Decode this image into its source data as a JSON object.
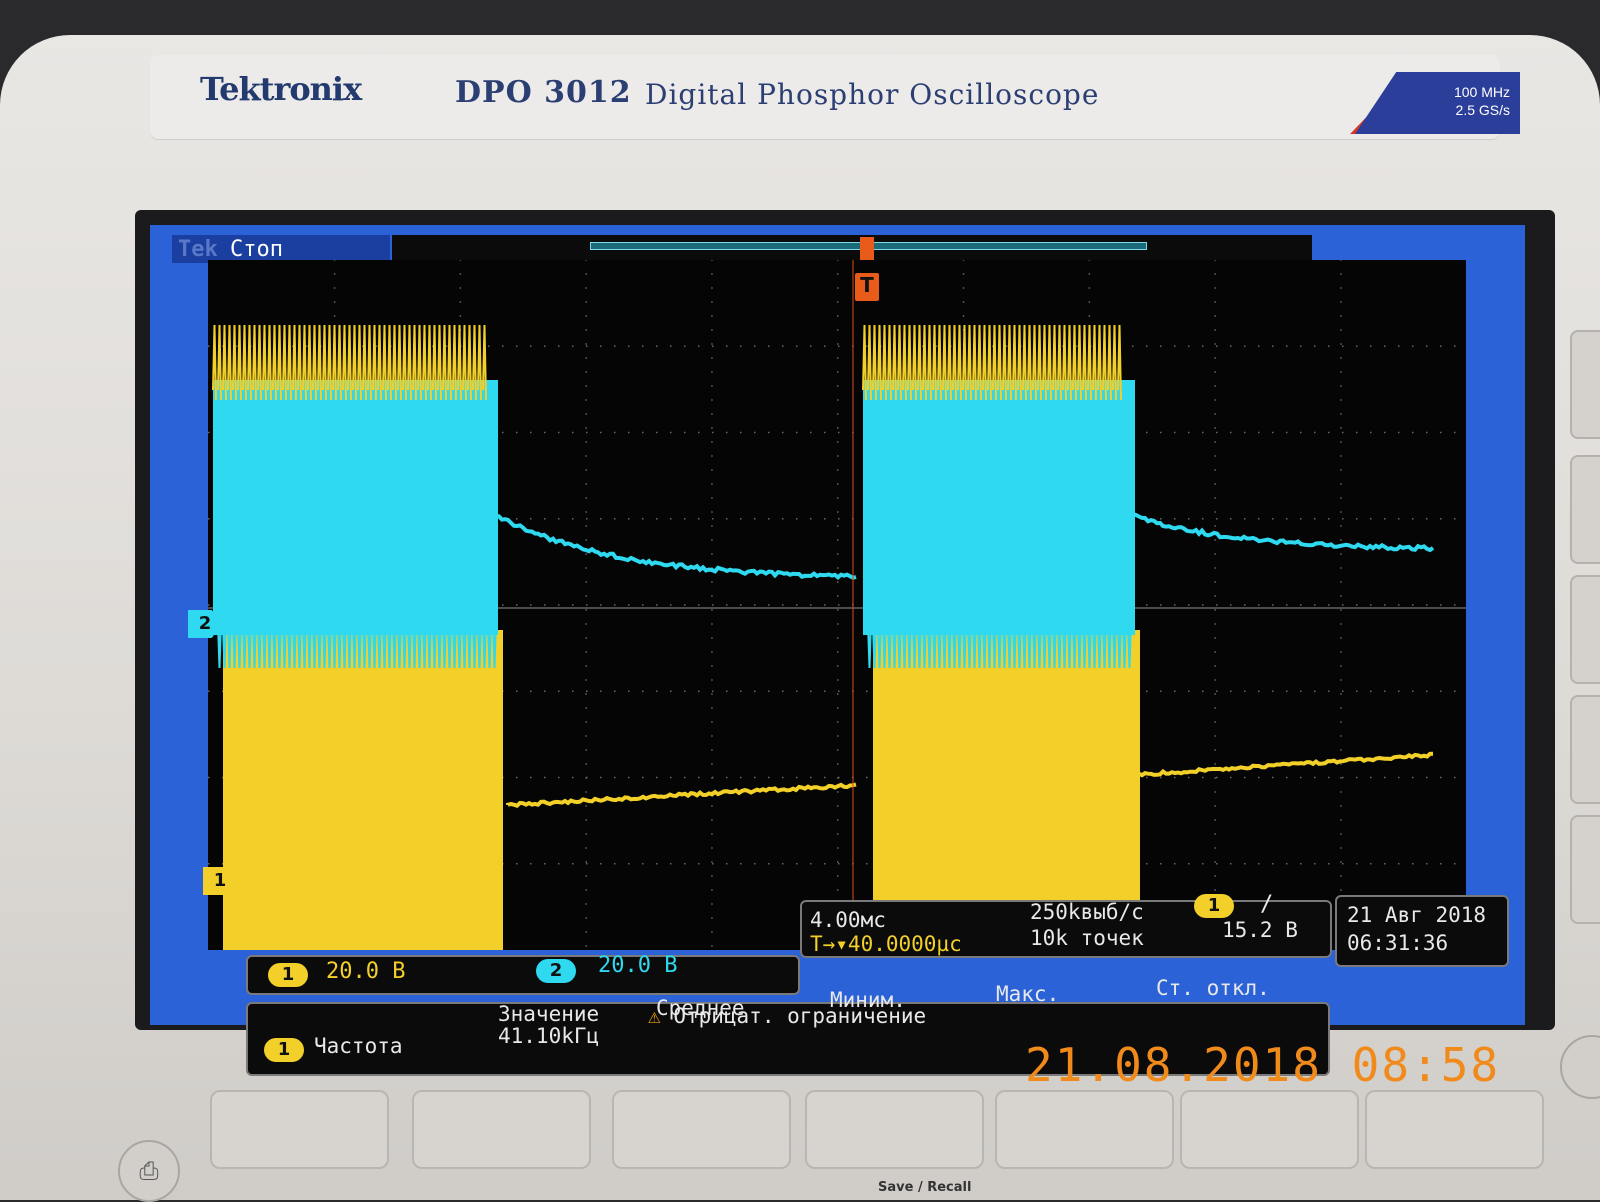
{
  "branding": {
    "brand": "Tektronix",
    "model": "DPO 3012",
    "model_desc": "Digital Phosphor Oscilloscope",
    "spec_bandwidth": "100 MHz",
    "spec_sample": "2.5 GS/s"
  },
  "screen": {
    "status": "Стоп",
    "logo": "Tek"
  },
  "channels": {
    "ch1": {
      "label": "1",
      "scale": "20.0 В",
      "color": "#f2d029"
    },
    "ch2": {
      "label": "2",
      "scale": "20.0 В",
      "color": "#2fd9ef"
    }
  },
  "timebase": {
    "time_div": "4.00мс",
    "trigger_position": "T→▾40.0000µс",
    "sample_rate": "250kвыб/с",
    "record_length": "10k точек"
  },
  "trigger": {
    "source": "1",
    "slope": "/",
    "level": "15.2 В"
  },
  "datetime": {
    "date": "21 Авг   2018",
    "time": "06:31:36"
  },
  "measurement": {
    "headers": {
      "value": "Значение",
      "mean": "Среднее",
      "min": "Миним.",
      "max": "Макс.",
      "std": "Ст. откл."
    },
    "source": "1",
    "name": "Частота",
    "value": "41.10kГц",
    "warning_icon": "warning-triangle-icon",
    "warning": "Отрицат. ограничение"
  },
  "photo_stamp": "21.08.2018  08:58",
  "front_panel": {
    "save_recall": "Save / Recall"
  }
}
